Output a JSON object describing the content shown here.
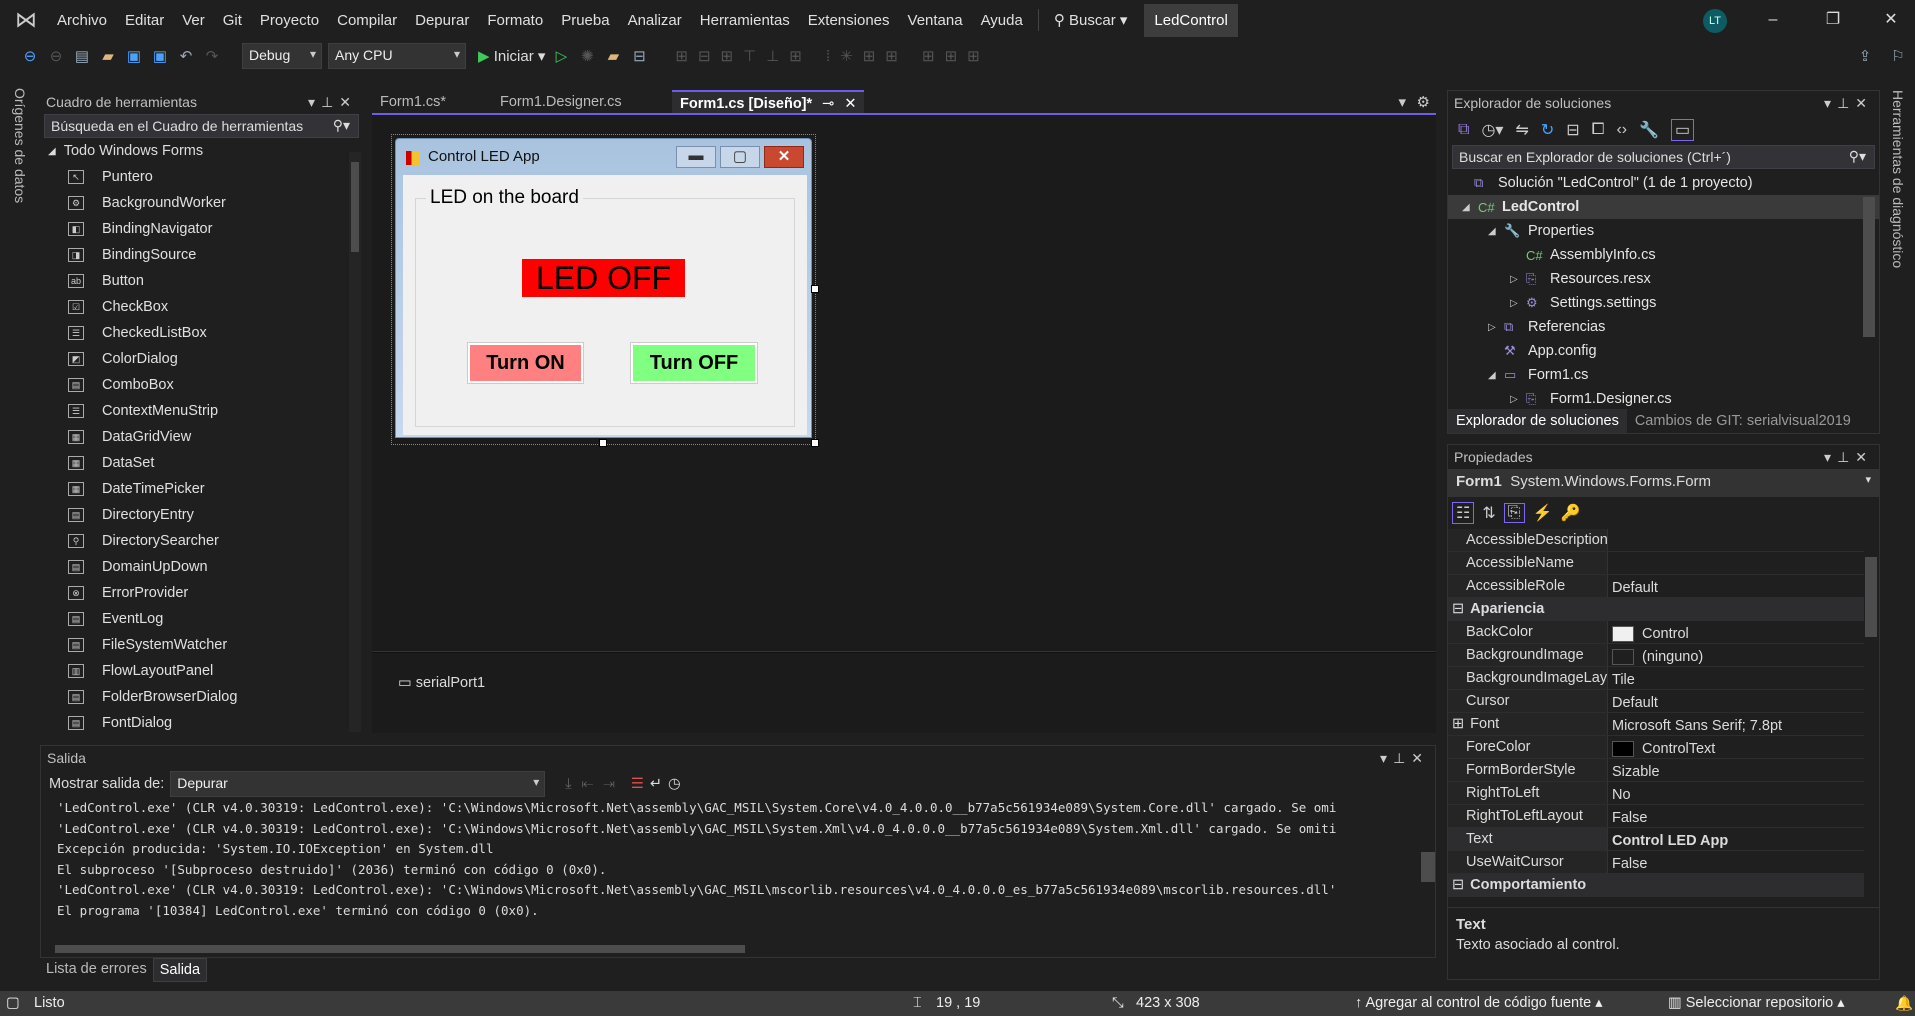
{
  "menu": {
    "items": [
      "Archivo",
      "Editar",
      "Ver",
      "Git",
      "Proyecto",
      "Compilar",
      "Depurar",
      "Formato",
      "Prueba",
      "Analizar",
      "Herramientas",
      "Extensiones",
      "Ventana",
      "Ayuda"
    ],
    "search": "Buscar",
    "solution_badge": "LedControl",
    "avatar": "LT"
  },
  "toolbar": {
    "config": "Debug",
    "platform": "Any CPU",
    "start": "Iniciar"
  },
  "left_strip": "Orígenes de datos",
  "right_strip": "Herramientas de diagnóstico",
  "toolbox": {
    "title": "Cuadro de herramientas",
    "search_placeholder": "Búsqueda en el Cuadro de herramientas",
    "group": "Todo Windows Forms",
    "items": [
      "Puntero",
      "BackgroundWorker",
      "BindingNavigator",
      "BindingSource",
      "Button",
      "CheckBox",
      "CheckedListBox",
      "ColorDialog",
      "ComboBox",
      "ContextMenuStrip",
      "DataGridView",
      "DataSet",
      "DateTimePicker",
      "DirectoryEntry",
      "DirectorySearcher",
      "DomainUpDown",
      "ErrorProvider",
      "EventLog",
      "FileSystemWatcher",
      "FlowLayoutPanel",
      "FolderBrowserDialog",
      "FontDialog"
    ]
  },
  "editor": {
    "tabs": [
      "Form1.cs*",
      "Form1.Designer.cs",
      "Form1.cs [Diseño]*"
    ],
    "active_tab": 2,
    "tray_component": "serialPort1"
  },
  "form": {
    "title": "Control LED App",
    "group_label": "LED on the board",
    "led_label": "LED OFF",
    "btn_on": "Turn ON",
    "btn_off": "Turn OFF",
    "colors": {
      "led": "#ff0000",
      "on": "#ff8080",
      "off": "#80ff80"
    }
  },
  "solution": {
    "title": "Explorador de soluciones",
    "search_placeholder": "Buscar en Explorador de soluciones (Ctrl+´)",
    "rows": [
      {
        "label": "Solución \"LedControl\"  (1 de 1 proyecto)",
        "arrow": ""
      },
      {
        "label": "LedControl",
        "arrow": "◢",
        "bold": true
      },
      {
        "label": "Properties",
        "arrow": "◢"
      },
      {
        "label": "AssemblyInfo.cs",
        "arrow": ""
      },
      {
        "label": "Resources.resx",
        "arrow": "▷"
      },
      {
        "label": "Settings.settings",
        "arrow": "▷"
      },
      {
        "label": "Referencias",
        "arrow": "▷"
      },
      {
        "label": "App.config",
        "arrow": ""
      },
      {
        "label": "Form1.cs",
        "arrow": "◢"
      },
      {
        "label": "Form1.Designer.cs",
        "arrow": "▷"
      }
    ],
    "bottom_tabs": [
      "Explorador de soluciones",
      "Cambios de GIT: serialvisual2019"
    ]
  },
  "properties": {
    "title": "Propiedades",
    "object_name": "Form1",
    "object_type": "System.Windows.Forms.Form",
    "rows": [
      {
        "k": "AccessibleDescription",
        "v": ""
      },
      {
        "k": "AccessibleName",
        "v": ""
      },
      {
        "k": "AccessibleRole",
        "v": "Default"
      },
      {
        "cat": "Apariencia"
      },
      {
        "k": "BackColor",
        "v": "Control",
        "swatch": "#f0f0f0"
      },
      {
        "k": "BackgroundImage",
        "v": "(ninguno)",
        "swatch": "#1f1f1f"
      },
      {
        "k": "BackgroundImageLayout",
        "v": "Tile"
      },
      {
        "k": "Cursor",
        "v": "Default"
      },
      {
        "k": "Font",
        "v": "Microsoft Sans Serif; 7.8pt",
        "expand": true
      },
      {
        "k": "ForeColor",
        "v": "ControlText",
        "swatch": "#000000"
      },
      {
        "k": "FormBorderStyle",
        "v": "Sizable"
      },
      {
        "k": "RightToLeft",
        "v": "No"
      },
      {
        "k": "RightToLeftLayout",
        "v": "False"
      },
      {
        "k": "Text",
        "v": "Control LED App",
        "bold": true
      },
      {
        "k": "UseWaitCursor",
        "v": "False"
      },
      {
        "cat": "Comportamiento"
      }
    ],
    "desc_title": "Text",
    "desc": "Texto asociado al control."
  },
  "output": {
    "title": "Salida",
    "show_label": "Mostrar salida de:",
    "source": "Depurar",
    "lines": [
      "'LedControl.exe' (CLR v4.0.30319: LedControl.exe): 'C:\\Windows\\Microsoft.Net\\assembly\\GAC_MSIL\\System.Core\\v4.0_4.0.0.0__b77a5c561934e089\\System.Core.dll' cargado. Se omi",
      "'LedControl.exe' (CLR v4.0.30319: LedControl.exe): 'C:\\Windows\\Microsoft.Net\\assembly\\GAC_MSIL\\System.Xml\\v4.0_4.0.0.0__b77a5c561934e089\\System.Xml.dll' cargado. Se omiti",
      "Excepción producida: 'System.IO.IOException' en System.dll",
      "El subproceso '[Subproceso destruido]' (2036) terminó con código 0 (0x0).",
      "'LedControl.exe' (CLR v4.0.30319: LedControl.exe): 'C:\\Windows\\Microsoft.Net\\assembly\\GAC_MSIL\\mscorlib.resources\\v4.0_4.0.0.0_es_b77a5c561934e089\\mscorlib.resources.dll'",
      "El programa '[10384] LedControl.exe' terminó con código 0 (0x0)."
    ],
    "bottom_tabs": [
      "Lista de errores",
      "Salida"
    ]
  },
  "status": {
    "ready": "Listo",
    "position": "19 , 19",
    "size": "423 x 308",
    "source_control": "Agregar al control de código fuente",
    "repo": "Seleccionar repositorio"
  }
}
